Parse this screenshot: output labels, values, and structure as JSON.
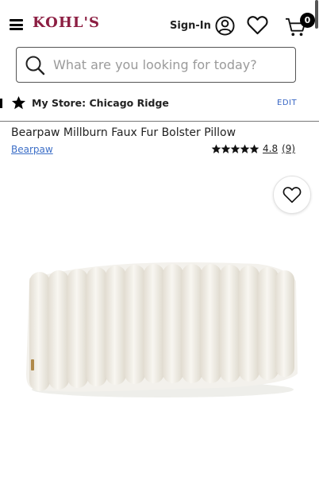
{
  "header": {
    "logo": "KOHL'S",
    "signin_label": "Sign-In",
    "cart_count": "0",
    "icons": {
      "menu": "hamburger-menu-icon",
      "account": "user-icon",
      "wishlist": "heart-icon",
      "cart": "cart-icon"
    },
    "brand_color": "#8c1e42"
  },
  "search": {
    "placeholder": "What are you looking for today?"
  },
  "store": {
    "label": "My Store: Chicago Ridge",
    "edit_label": "EDIT"
  },
  "product": {
    "title": "Bearpaw Millburn Faux Fur Bolster Pillow",
    "brand": "Bearpaw",
    "rating_value": "4.8",
    "rating_count": "(9)",
    "stars": 5
  },
  "colors": {
    "link": "#3d6fc7",
    "edit": "#3866c4"
  }
}
